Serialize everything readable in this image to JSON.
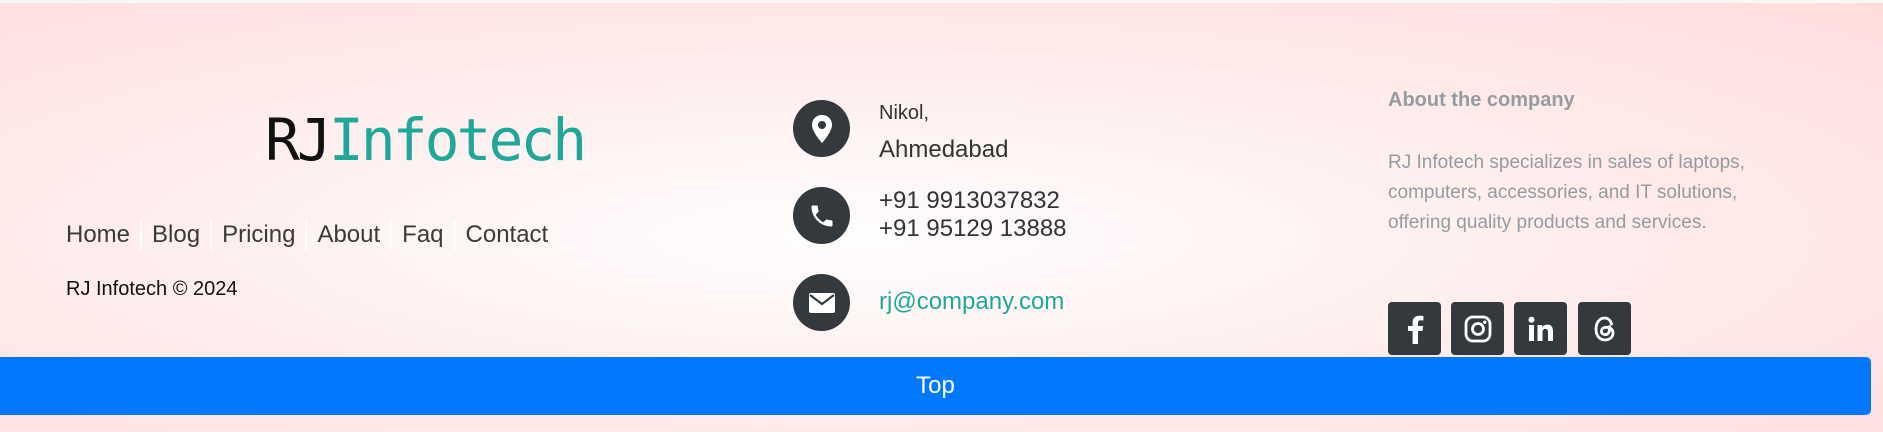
{
  "brand": {
    "logo_part1": "RJ",
    "logo_part2": "Infotech",
    "logo_colors": {
      "part1": "#111111",
      "part2": "#1fa89a"
    }
  },
  "nav": {
    "items": [
      {
        "label": "Home"
      },
      {
        "label": "Blog"
      },
      {
        "label": "Pricing"
      },
      {
        "label": "About"
      },
      {
        "label": "Faq"
      },
      {
        "label": "Contact"
      }
    ]
  },
  "copyright": "RJ Infotech © 2024",
  "contact": {
    "address_line1": "Nikol,",
    "address_line2": "Ahmedabad",
    "phone1": "+91 9913037832",
    "phone2": "+91 95129 13888",
    "email": "rj@company.com",
    "icons": [
      "location-pin-icon",
      "phone-icon",
      "envelope-icon"
    ]
  },
  "about": {
    "title": "About the company",
    "text": "RJ Infotech specializes in sales of laptops, computers, accessories, and IT solutions, offering quality products and services."
  },
  "social": {
    "icons": [
      "facebook-icon",
      "instagram-icon",
      "linkedin-icon",
      "threads-icon"
    ]
  },
  "top_button": {
    "label": "Top",
    "color": "#0078ff"
  },
  "colors": {
    "accent": "#1fa89a",
    "icon_bg": "#33393d",
    "muted_text": "#969ba1"
  }
}
